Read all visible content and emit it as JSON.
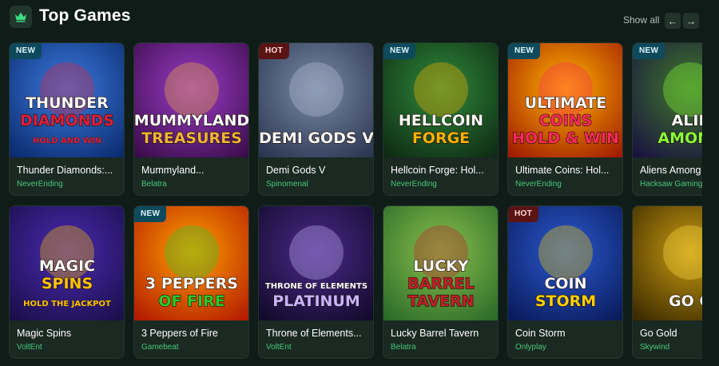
{
  "header": {
    "icon": "crown-icon",
    "title": "Top Games",
    "show_all": "Show all",
    "prev_icon": "arrow-left-icon",
    "next_icon": "arrow-right-icon"
  },
  "games": [
    {
      "title": "Thunder Diamonds:...",
      "provider": "NeverEnding",
      "badge": "NEW",
      "art_lines": [
        "THUNDER",
        "DIAMONDS",
        "HOLD AND WIN"
      ],
      "colors": {
        "bg1": "#0b2b6e",
        "bg2": "#3b7be0",
        "accent": "#e0203a"
      }
    },
    {
      "title": "Mummyland...",
      "provider": "Belatra",
      "badge": "",
      "art_lines": [
        "MUMMYLAND",
        "TREASURES"
      ],
      "colors": {
        "bg1": "#3a0d4a",
        "bg2": "#9b3bc6",
        "accent": "#f0b43a"
      }
    },
    {
      "title": "Demi Gods V",
      "provider": "Spinomenal",
      "badge": "HOT",
      "art_lines": [
        "DEMI GODS V"
      ],
      "colors": {
        "bg1": "#2a3550",
        "bg2": "#7a8aa8",
        "accent": "#b9c2d6"
      }
    },
    {
      "title": "Hellcoin Forge: Hol...",
      "provider": "NeverEnding",
      "badge": "NEW",
      "art_lines": [
        "HELLCOIN",
        "FORGE"
      ],
      "colors": {
        "bg1": "#0f2a14",
        "bg2": "#2f8a3a",
        "accent": "#ffb300"
      }
    },
    {
      "title": "Ultimate Coins: Hol...",
      "provider": "NeverEnding",
      "badge": "NEW",
      "art_lines": [
        "ULTIMATE",
        "COINS",
        "HOLD & WIN"
      ],
      "colors": {
        "bg1": "#a01a00",
        "bg2": "#ffb400",
        "accent": "#ff2a5c"
      }
    },
    {
      "title": "Aliens Among Us",
      "provider": "Hacksaw Gaming",
      "badge": "NEW",
      "art_lines": [
        "ALIE",
        "AMONG"
      ],
      "colors": {
        "bg1": "#1a1240",
        "bg2": "#3f7a2a",
        "accent": "#8cff3a"
      }
    },
    {
      "title": "Magic Spins",
      "provider": "VoltEnt",
      "badge": "",
      "art_lines": [
        "MAGIC",
        "SPINS",
        "HOLD THE JACKPOT"
      ],
      "colors": {
        "bg1": "#1a0f4a",
        "bg2": "#4a2ab0",
        "accent": "#ffc400"
      }
    },
    {
      "title": "3 Peppers of Fire",
      "provider": "Gamebeat",
      "badge": "NEW",
      "art_lines": [
        "3 PEPPERS",
        "OF FIRE"
      ],
      "colors": {
        "bg1": "#b31a00",
        "bg2": "#ffa000",
        "accent": "#2fc82a"
      }
    },
    {
      "title": "Throne of Elements...",
      "provider": "VoltEnt",
      "badge": "",
      "art_lines": [
        "THRONE OF ELEMENTS",
        "PLATINUM"
      ],
      "colors": {
        "bg1": "#120a2a",
        "bg2": "#4a2a8a",
        "accent": "#c8b4ff"
      }
    },
    {
      "title": "Lucky Barrel Tavern",
      "provider": "Belatra",
      "badge": "",
      "art_lines": [
        "LUCKY",
        "BARREL",
        "TAVERN"
      ],
      "colors": {
        "bg1": "#2a6a2a",
        "bg2": "#8ac04a",
        "accent": "#c0202a"
      }
    },
    {
      "title": "Coin Storm",
      "provider": "Onlyplay",
      "badge": "HOT",
      "art_lines": [
        "COIN",
        "STORM"
      ],
      "colors": {
        "bg1": "#0a1a5a",
        "bg2": "#2a5ad0",
        "accent": "#ffd000"
      }
    },
    {
      "title": "Go Gold",
      "provider": "Skywind",
      "badge": "",
      "art_lines": [
        "GO G"
      ],
      "colors": {
        "bg1": "#3a2a00",
        "bg2": "#c89a10",
        "accent": "#ffe04a"
      }
    }
  ]
}
